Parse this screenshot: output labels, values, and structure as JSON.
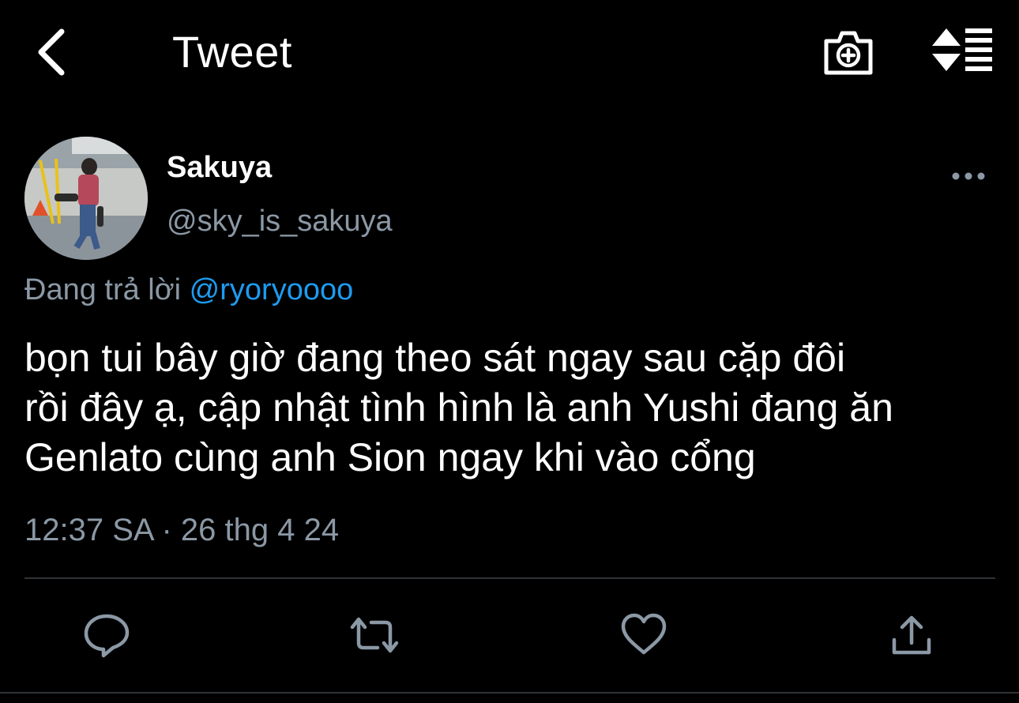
{
  "header": {
    "title": "Tweet",
    "back_icon": "chevron-left-icon",
    "camera_icon": "camera-plus-icon",
    "sort_icon": "sort-arrows-icon"
  },
  "author": {
    "display_name": "Sakuya",
    "handle": "@sky_is_sakuya",
    "more_icon": "more-horizontal-icon"
  },
  "reply": {
    "prefix": "Đang trả lời",
    "mention": "@ryoryoooo"
  },
  "tweet": {
    "lines": [
      "bọn tui bây giờ đang theo sát ngay sau cặp đôi",
      "rồi đây ạ, cập nhật tình hình là anh Yushi đang ăn",
      "Genlato cùng anh Sion ngay khi vào cổng"
    ],
    "timestamp": "12:37 SA · 26 thg 4 24"
  },
  "actions": {
    "reply_icon": "reply-icon",
    "retweet_icon": "retweet-icon",
    "like_icon": "heart-icon",
    "share_icon": "share-icon"
  },
  "colors": {
    "background": "#000000",
    "text": "#ffffff",
    "secondary": "#8b98a5",
    "accent": "#1d9bf0",
    "divider": "#2f3336"
  }
}
